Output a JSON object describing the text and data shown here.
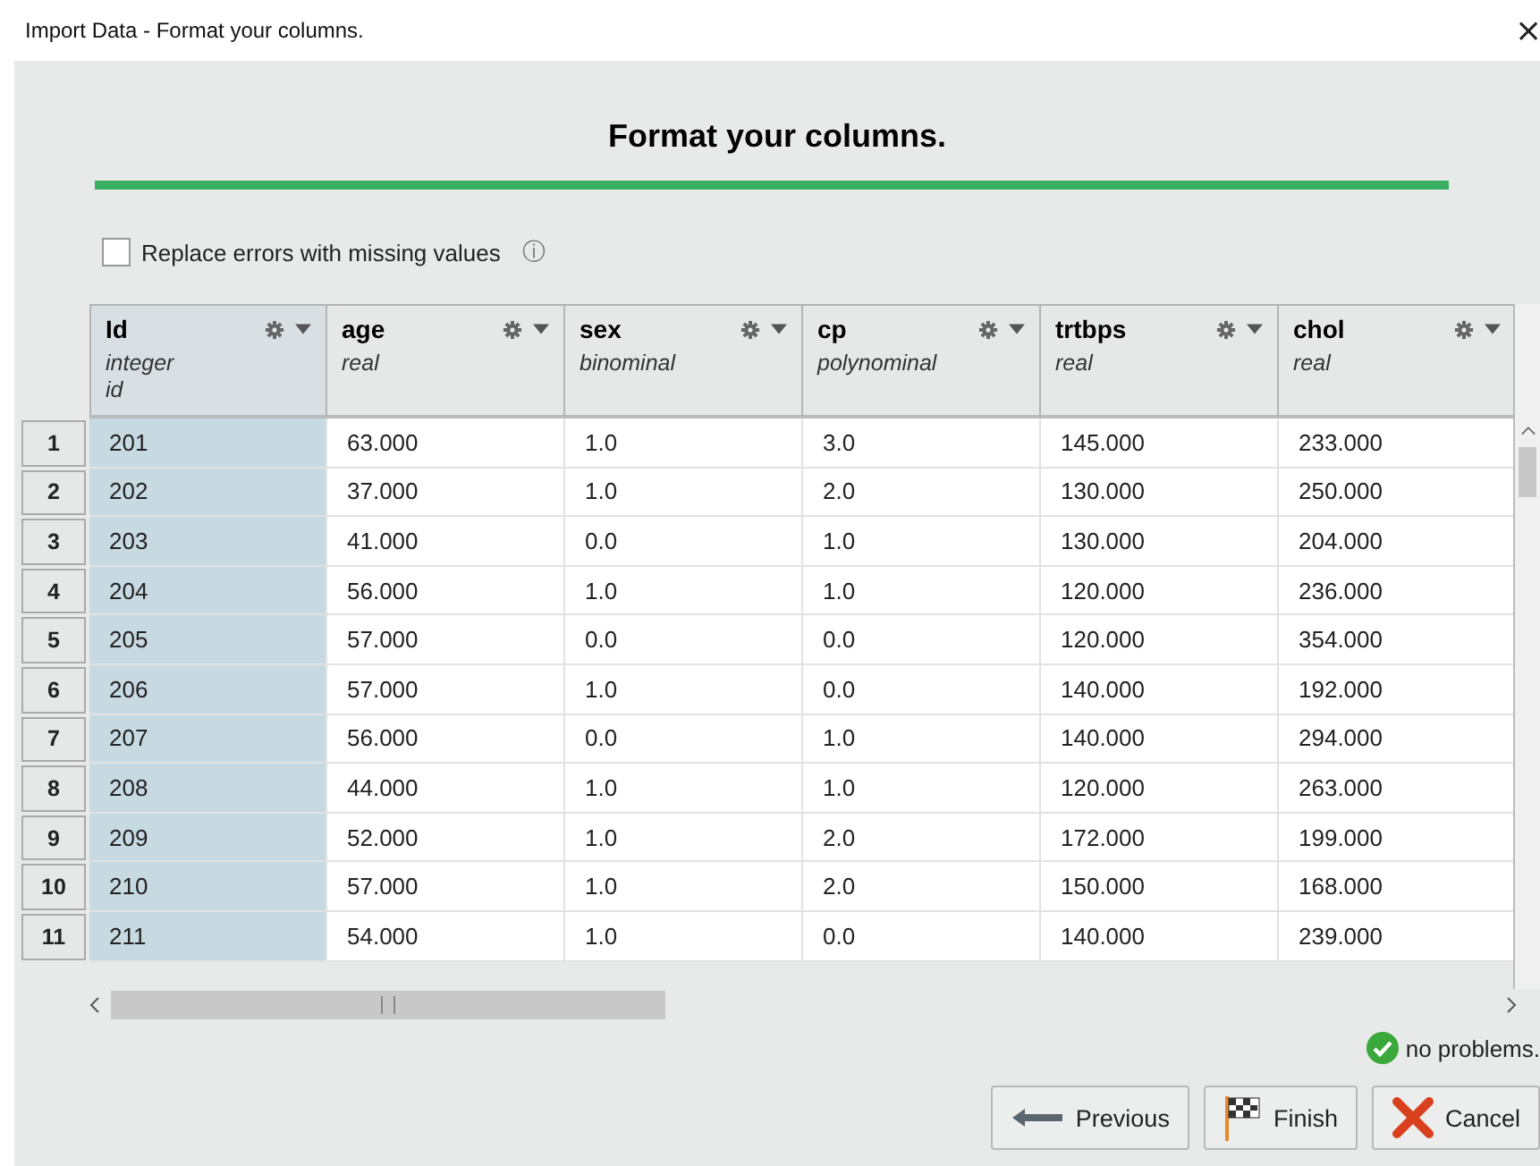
{
  "window": {
    "title": "Import Data - Format your columns.",
    "close": "×"
  },
  "heading": "Format your columns.",
  "replace_errors": {
    "label": "Replace errors with missing values",
    "checked": false,
    "info": "ⓘ"
  },
  "table": {
    "columns": [
      {
        "name": "Id",
        "type": "integer",
        "role": "id",
        "selected": true
      },
      {
        "name": "age",
        "type": "real",
        "selected": false
      },
      {
        "name": "sex",
        "type": "binominal",
        "selected": false
      },
      {
        "name": "cp",
        "type": "polynominal",
        "selected": false
      },
      {
        "name": "trtbps",
        "type": "real",
        "selected": false
      },
      {
        "name": "chol",
        "type": "real",
        "selected": false
      }
    ],
    "rows": [
      {
        "index": "1",
        "cells": [
          "201",
          "63.000",
          "1.0",
          "3.0",
          "145.000",
          "233.000"
        ]
      },
      {
        "index": "2",
        "cells": [
          "202",
          "37.000",
          "1.0",
          "2.0",
          "130.000",
          "250.000"
        ]
      },
      {
        "index": "3",
        "cells": [
          "203",
          "41.000",
          "0.0",
          "1.0",
          "130.000",
          "204.000"
        ]
      },
      {
        "index": "4",
        "cells": [
          "204",
          "56.000",
          "1.0",
          "1.0",
          "120.000",
          "236.000"
        ]
      },
      {
        "index": "5",
        "cells": [
          "205",
          "57.000",
          "0.0",
          "0.0",
          "120.000",
          "354.000"
        ]
      },
      {
        "index": "6",
        "cells": [
          "206",
          "57.000",
          "1.0",
          "0.0",
          "140.000",
          "192.000"
        ]
      },
      {
        "index": "7",
        "cells": [
          "207",
          "56.000",
          "0.0",
          "1.0",
          "140.000",
          "294.000"
        ]
      },
      {
        "index": "8",
        "cells": [
          "208",
          "44.000",
          "1.0",
          "1.0",
          "120.000",
          "263.000"
        ]
      },
      {
        "index": "9",
        "cells": [
          "209",
          "52.000",
          "1.0",
          "2.0",
          "172.000",
          "199.000"
        ]
      },
      {
        "index": "10",
        "cells": [
          "210",
          "57.000",
          "1.0",
          "2.0",
          "150.000",
          "168.000"
        ]
      },
      {
        "index": "11",
        "cells": [
          "211",
          "54.000",
          "1.0",
          "0.0",
          "140.000",
          "239.000"
        ]
      }
    ]
  },
  "status": "no problems.",
  "buttons": [
    {
      "kind": "previous",
      "label": "Previous"
    },
    {
      "kind": "finish",
      "label": "Finish"
    },
    {
      "kind": "cancel",
      "label": "Cancel"
    }
  ]
}
